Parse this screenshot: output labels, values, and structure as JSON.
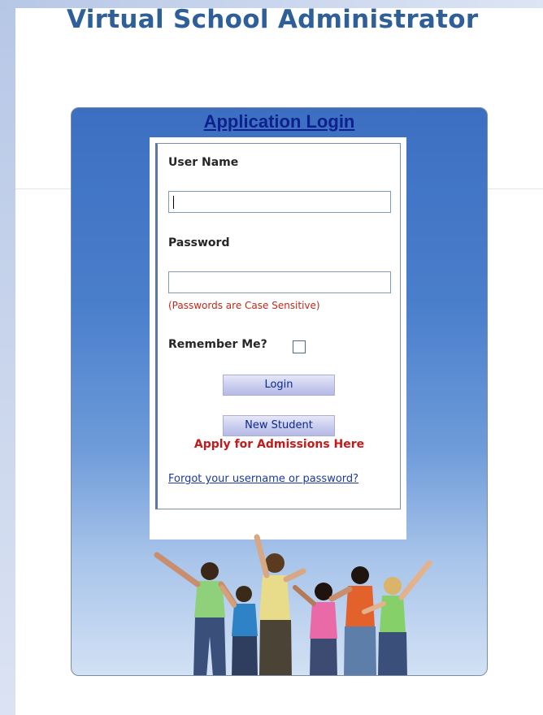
{
  "header": {
    "app_title": "Virtual School Administrator"
  },
  "login": {
    "panel_title": "Application Login",
    "username_label": "User Name",
    "username_value": "",
    "password_label": "Password",
    "password_value": "",
    "password_hint": "(Passwords are Case Sensitive)",
    "remember_label": "Remember Me?",
    "remember_checked": false,
    "login_button": "Login",
    "new_student_button": "New Student",
    "apply_text": "Apply for Admissions Here",
    "forgot_link": "Forgot your username or password?"
  },
  "colors": {
    "title": "#2f5f98",
    "panel_title": "#0e1f8e",
    "hint_red": "#c0291c",
    "apply_red": "#c41a1a",
    "link": "#1b3ba0",
    "panel_blue": "#3c6fc1"
  },
  "image": {
    "icon": "group-of-students-photo"
  }
}
